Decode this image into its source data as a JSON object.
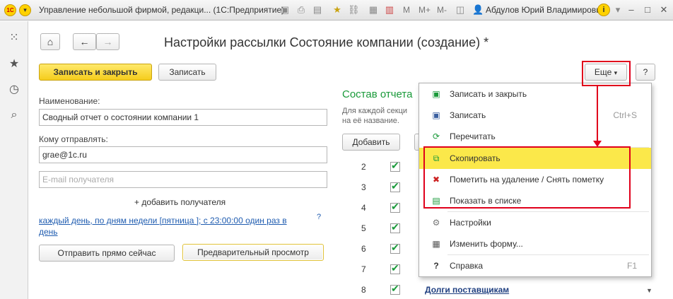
{
  "titlebar": {
    "app_logo": "1С",
    "title": "Управление небольшой фирмой, редакци...  (1С:Предприятие)",
    "m_label": "M",
    "m_plus": "M+",
    "m_minus": "M-",
    "user": "Абдулов Юрий Владимирович",
    "icons": [
      "save-icon",
      "print-icon",
      "preview-icon",
      "favorite-icon",
      "link-icon",
      "calculator-icon",
      "calendar-icon"
    ]
  },
  "rail": {
    "icons": [
      "grid-icon",
      "star-icon",
      "history-icon",
      "search-icon"
    ]
  },
  "form": {
    "title": "Настройки рассылки Состояние компании (создание) *",
    "save_close": "Записать и закрыть",
    "save": "Записать",
    "more": "Еще",
    "help": "?",
    "name_label": "Наименование:",
    "name_value": "Сводный отчет о состоянии компании 1",
    "to_label": "Кому отправлять:",
    "to_value": "grae@1c.ru",
    "email_placeholder": "E-mail получателя",
    "add_recipient": "+ добавить получателя",
    "schedule_line1": "каждый  день, по дням недели [пятница ]; с 23:00:00 один раз в",
    "schedule_line2": "день",
    "schedule_help": "?",
    "send_now": "Отправить прямо сейчас",
    "preview": "Предварительный просмотр"
  },
  "report": {
    "title": "Состав отчета",
    "desc_line1": "Для каждой секци",
    "desc_line2": "на её название.",
    "add": "Добавить",
    "rows": [
      {
        "num": "2",
        "name": ""
      },
      {
        "num": "3",
        "name": ""
      },
      {
        "num": "4",
        "name": ""
      },
      {
        "num": "5",
        "name": ""
      },
      {
        "num": "6",
        "name": ""
      },
      {
        "num": "7",
        "name": ""
      },
      {
        "num": "8",
        "name": "Долги поставщикам"
      }
    ]
  },
  "menu": {
    "items": [
      {
        "icon": "save-close-icon",
        "label": "Записать и закрыть",
        "key": ""
      },
      {
        "icon": "save-icon",
        "label": "Записать",
        "key": "Ctrl+S"
      },
      {
        "icon": "reread-icon",
        "label": "Перечитать",
        "key": ""
      },
      {
        "icon": "copy-icon",
        "label": "Скопировать",
        "key": ""
      },
      {
        "icon": "delete-mark-icon",
        "label": "Пометить на удаление / Снять пометку",
        "key": ""
      },
      {
        "icon": "show-in-list-icon",
        "label": "Показать в списке",
        "key": ""
      },
      {
        "icon": "settings-icon",
        "label": "Настройки",
        "key": ""
      },
      {
        "icon": "change-form-icon",
        "label": "Изменить форму...",
        "key": ""
      },
      {
        "icon": "help-icon",
        "label": "Справка",
        "key": "F1"
      }
    ]
  },
  "colors": {
    "accent_yellow": "#f5cd1c",
    "highlight": "#fbe84a",
    "annotation_red": "#e0001b",
    "section_green": "#1a9a3a",
    "link_blue": "#1f5cb0"
  }
}
